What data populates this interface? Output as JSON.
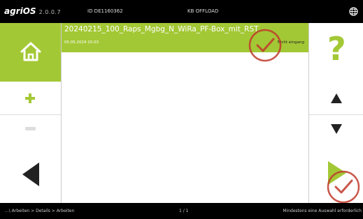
{
  "topbar": {
    "brand": "agriOS",
    "version": "2.0.0.7",
    "device_id": "ID DE1160362",
    "state": "KB OFFLOAD",
    "globe_icon": "globe-icon"
  },
  "left": {
    "home_icon": "home-icon",
    "add_icon": "plus-icon",
    "remove_icon": "minus-icon",
    "back_icon": "arrow-left-icon"
  },
  "list": {
    "items": [
      {
        "title": "20240215_100_Raps_Mgbg_N_WiRa_PF-Box_mit_RST",
        "date": "05.05.2024  15:03",
        "status": "Nicht eingang",
        "selected": true
      }
    ]
  },
  "right": {
    "help_label": "?",
    "up_icon": "arrow-up-icon",
    "down_icon": "arrow-down-icon",
    "next_icon": "arrow-right-icon"
  },
  "bottombar": {
    "breadcrumb": "...\\ Arbeiten > Details > Arbeiten",
    "pager": "1 / 1",
    "hint": "Mindestens eine Auswahl erforderlich"
  },
  "colors": {
    "accent": "#a3c835",
    "overlay_check": "#c0392b"
  }
}
